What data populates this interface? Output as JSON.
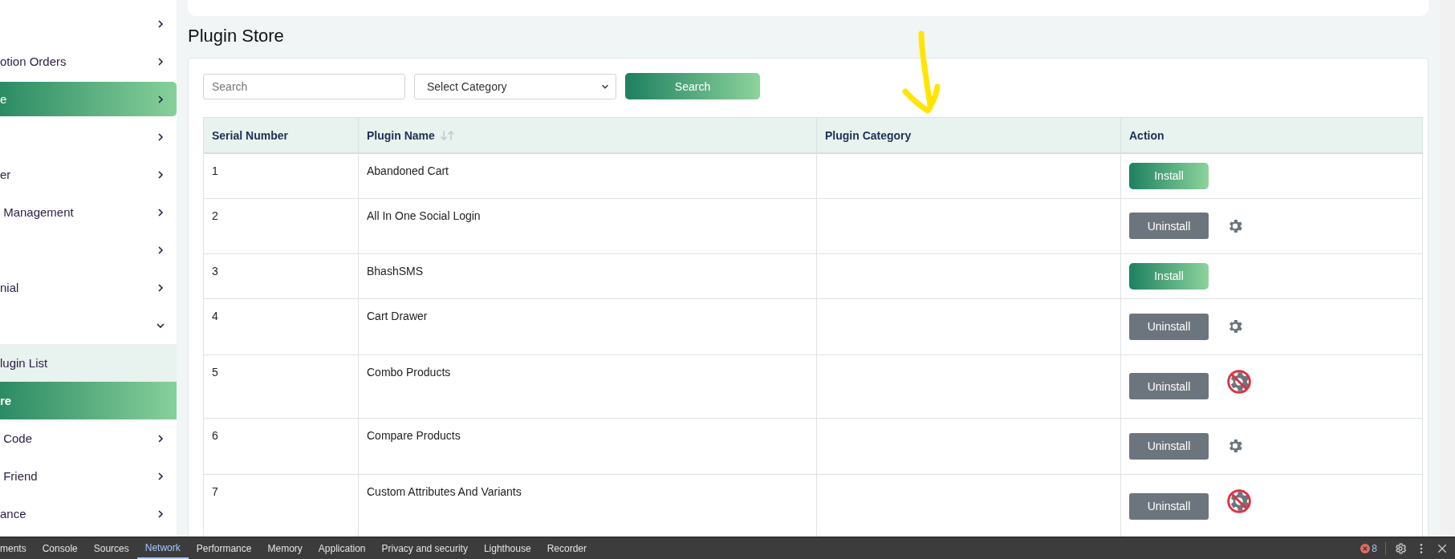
{
  "sidebar": {
    "items": [
      {
        "selected": false,
        "expanded": false
      },
      {
        "label": "otion Orders",
        "selected": false,
        "expanded": false
      },
      {
        "label": "e",
        "selected": true,
        "expanded": false
      },
      {
        "selected": false,
        "expanded": false
      },
      {
        "label": "er",
        "selected": false,
        "expanded": false
      },
      {
        "label": " Management",
        "selected": false,
        "expanded": false
      },
      {
        "selected": false,
        "expanded": false
      },
      {
        "label": "nial",
        "selected": false,
        "expanded": false
      },
      {
        "selected": false,
        "expanded": true,
        "children": [
          {
            "label": "lugin List",
            "selected": false
          },
          {
            "label": "re",
            "selected": true
          }
        ]
      },
      {
        "label": " Code",
        "selected": false,
        "expanded": false
      },
      {
        "label": " Friend",
        "selected": false,
        "expanded": false
      },
      {
        "label": "ance",
        "selected": false,
        "expanded": false
      }
    ]
  },
  "page_title": "Plugin Store",
  "filters": {
    "search": {
      "placeholder": "Search"
    },
    "category": {
      "value": "Select Category"
    },
    "button": "Search"
  },
  "table": {
    "columns": [
      "Serial Number",
      "Plugin Name",
      "Plugin Category",
      "Action"
    ],
    "rows": [
      {
        "serial": "1",
        "name": "Abandoned Cart",
        "installed": false,
        "action": "Install",
        "kind": "plain"
      },
      {
        "serial": "2",
        "name": "All In One Social Login",
        "installed": true,
        "action": "Uninstall",
        "kind": "configurable"
      },
      {
        "serial": "3",
        "name": "BhashSMS",
        "installed": false,
        "action": "Install",
        "kind": "plain"
      },
      {
        "serial": "4",
        "name": "Cart Drawer",
        "installed": true,
        "action": "Uninstall",
        "kind": "configurable"
      },
      {
        "serial": "5",
        "name": "Combo Products",
        "installed": true,
        "action": "Uninstall",
        "kind": "blocked"
      },
      {
        "serial": "6",
        "name": "Compare Products",
        "installed": true,
        "action": "Uninstall",
        "kind": "configurable"
      },
      {
        "serial": "7",
        "name": "Custom Attributes And Variants",
        "installed": true,
        "action": "Uninstall",
        "kind": "blocked"
      }
    ]
  },
  "devtools": {
    "tabs": [
      {
        "label": "ments",
        "selected": false
      },
      {
        "label": "Console",
        "selected": false
      },
      {
        "label": "Sources",
        "selected": false
      },
      {
        "label": "Network",
        "selected": true
      },
      {
        "label": "Performance",
        "selected": false
      },
      {
        "label": "Memory",
        "selected": false
      },
      {
        "label": "Application",
        "selected": false
      },
      {
        "label": "Privacy and security",
        "selected": false
      },
      {
        "label": "Lighthouse",
        "selected": false
      },
      {
        "label": "Recorder",
        "selected": false
      }
    ],
    "error_count": "8"
  }
}
